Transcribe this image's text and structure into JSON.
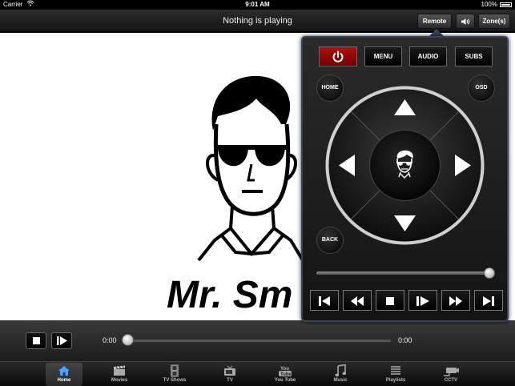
{
  "status_bar": {
    "carrier": "Carrier",
    "time": "9:01 AM",
    "battery": "100%"
  },
  "top_bar": {
    "title": "Nothing is playing",
    "remote_label": "Remote",
    "volume_icon": "speaker-icon",
    "zones_label": "Zone(s)"
  },
  "artwork": {
    "text": "Mr. Sm"
  },
  "playback": {
    "current_time": "0:00",
    "total_time": "0:00",
    "progress": 0
  },
  "remote": {
    "power_icon": "power-icon",
    "menu_label": "MENU",
    "audio_label": "AUDIO",
    "subs_label": "SUBS",
    "home_label": "HOME",
    "osd_label": "OSD",
    "back_label": "BACK",
    "volume_level": 1.0,
    "power_color": "#a00000"
  },
  "tabs": [
    {
      "label": "Home",
      "icon": "house-icon",
      "active": true
    },
    {
      "label": "Movies",
      "icon": "clapper-icon",
      "active": false
    },
    {
      "label": "TV Shows",
      "icon": "film-icon",
      "active": false
    },
    {
      "label": "TV",
      "icon": "tv-icon",
      "active": false
    },
    {
      "label": "You Tube",
      "icon": "youtube-icon",
      "active": false
    },
    {
      "label": "Music",
      "icon": "music-note-icon",
      "active": false
    },
    {
      "label": "Playlists",
      "icon": "list-icon",
      "active": false
    },
    {
      "label": "CCTV",
      "icon": "camera-icon",
      "active": false
    }
  ],
  "colors": {
    "accent": "#4ea0ff",
    "popover_border": "#3a4258"
  }
}
